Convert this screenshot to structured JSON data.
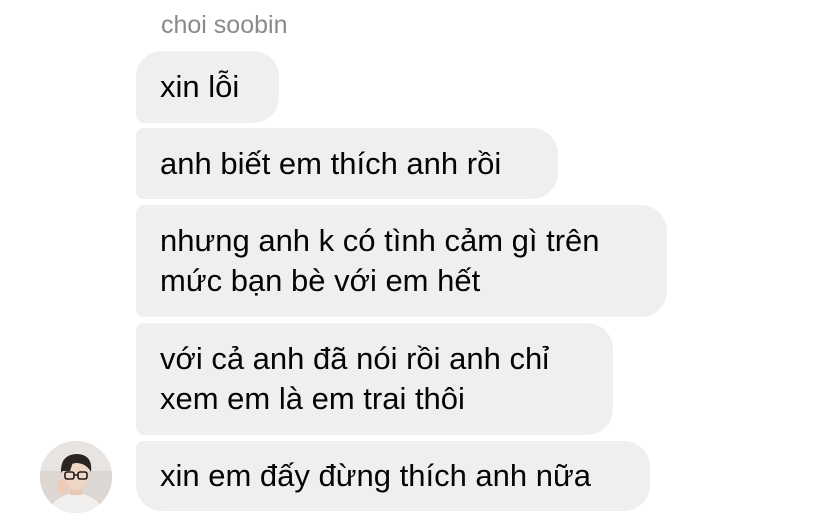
{
  "conversation": {
    "sender_name": "choi soobin",
    "messages": [
      {
        "lines": [
          "xin lỗi"
        ]
      },
      {
        "lines": [
          "anh biết em thích anh rồi"
        ]
      },
      {
        "lines": [
          "nhưng anh k có tình cảm gì trên",
          "mức bạn bè với em hết"
        ]
      },
      {
        "lines": [
          "với cả anh đã nói rồi anh chỉ",
          "xem em là em trai thôi"
        ]
      },
      {
        "lines": [
          "xin em đấy đừng thích anh nữa"
        ]
      }
    ],
    "colors": {
      "bubble_bg": "#efeff0",
      "bubble_text": "#050505",
      "sender_name_text": "#8a8a8e",
      "background": "#ffffff"
    }
  }
}
